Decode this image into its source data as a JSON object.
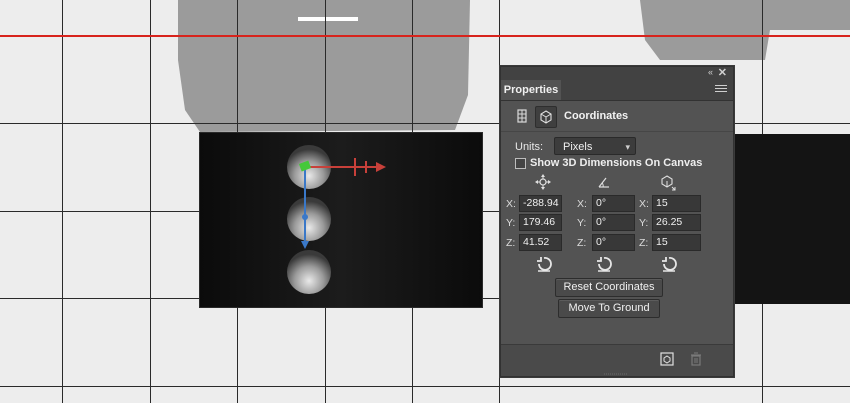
{
  "panel": {
    "tab_label": "Properties",
    "collapse_glyph": "«",
    "close_glyph": "✕",
    "mode_title": "Coordinates",
    "units_label": "Units:",
    "units_value": "Pixels",
    "checkbox_label": "Show 3D Dimensions On Canvas",
    "checkbox_checked": false,
    "position": {
      "x_label": "X:",
      "y_label": "Y:",
      "z_label": "Z:",
      "x": "-288.94",
      "y": "179.46",
      "z": "41.52"
    },
    "rotation": {
      "x_label": "X:",
      "y_label": "Y:",
      "z_label": "Z:",
      "x": "0°",
      "y": "0°",
      "z": "0°"
    },
    "scale": {
      "x_label": "X:",
      "y_label": "Y:",
      "z_label": "Z:",
      "x": "15",
      "y": "26.25",
      "z": "15"
    },
    "reset_button": "Reset Coordinates",
    "ground_button": "Move To Ground",
    "icons": [
      "mesh-icon",
      "coordinates-icon",
      "move-icon",
      "rotate-icon",
      "scale-icon",
      "reset-icon",
      "render-icon",
      "trash-icon"
    ]
  },
  "colors": {
    "panel_bg": "#535353",
    "guide": "#d8231c",
    "x_axis": "#c8403a",
    "y_axis": "#3a78c8",
    "z_axis": "#45c83a"
  }
}
